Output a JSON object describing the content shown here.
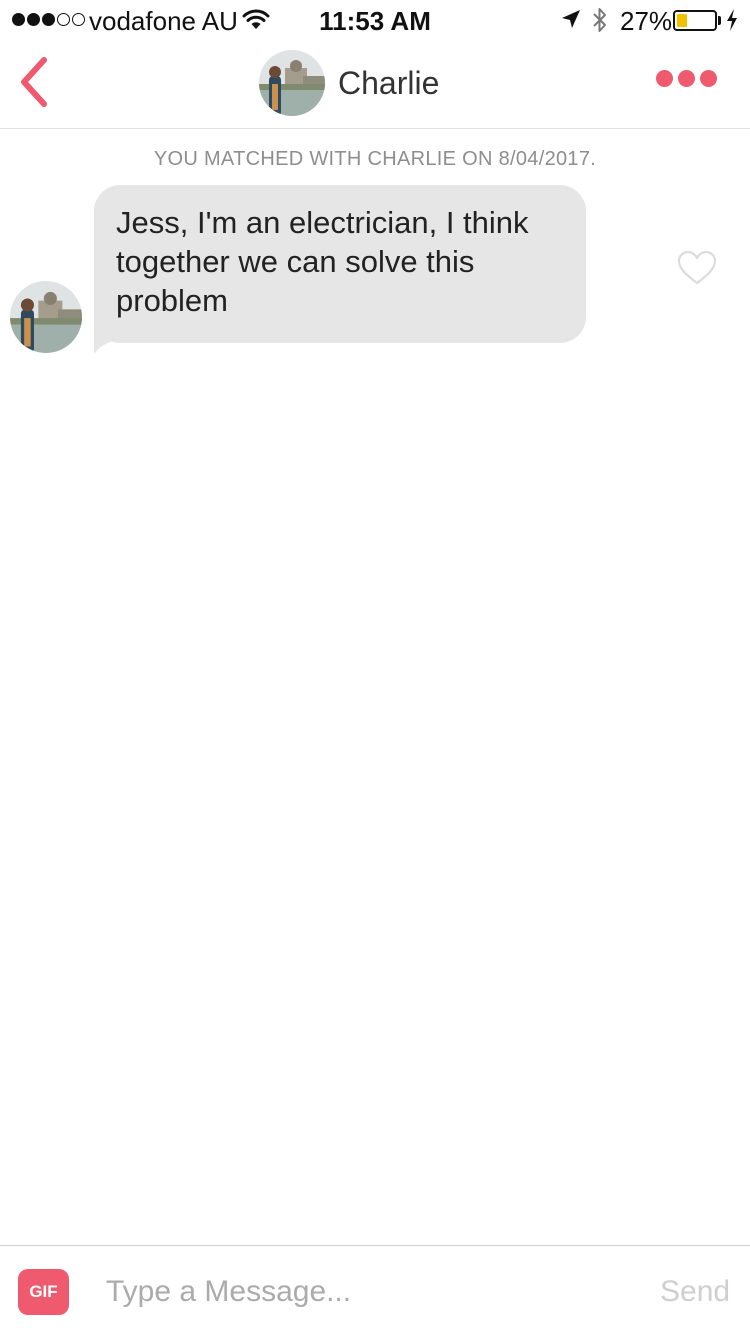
{
  "status_bar": {
    "carrier": "vodafone AU",
    "time": "11:53 AM",
    "battery_percent": "27%",
    "battery_level": 0.27,
    "signal_bars_filled": 3,
    "signal_bars_total": 5,
    "icons": [
      "wifi-icon",
      "location-arrow-icon",
      "bluetooth-icon",
      "battery-icon",
      "charging-bolt-icon"
    ]
  },
  "nav": {
    "title": "Charlie",
    "back_icon": "chevron-left-icon",
    "more_icon": "more-dots-icon"
  },
  "chat": {
    "match_banner": "YOU MATCHED WITH CHARLIE ON 8/04/2017.",
    "messages": [
      {
        "sender": "Charlie",
        "lines": [
          "Jess, I'm an electrician, I think",
          "together we can solve this",
          "problem"
        ],
        "liked": false
      }
    ]
  },
  "composer": {
    "gif_label": "GIF",
    "placeholder": "Type a Message...",
    "value": "",
    "send_label": "Send"
  },
  "colors": {
    "accent": "#f05a6e",
    "bubble": "#e6e6e6",
    "muted_text": "#8e8e8e",
    "battery_fill": "#f2c100"
  }
}
